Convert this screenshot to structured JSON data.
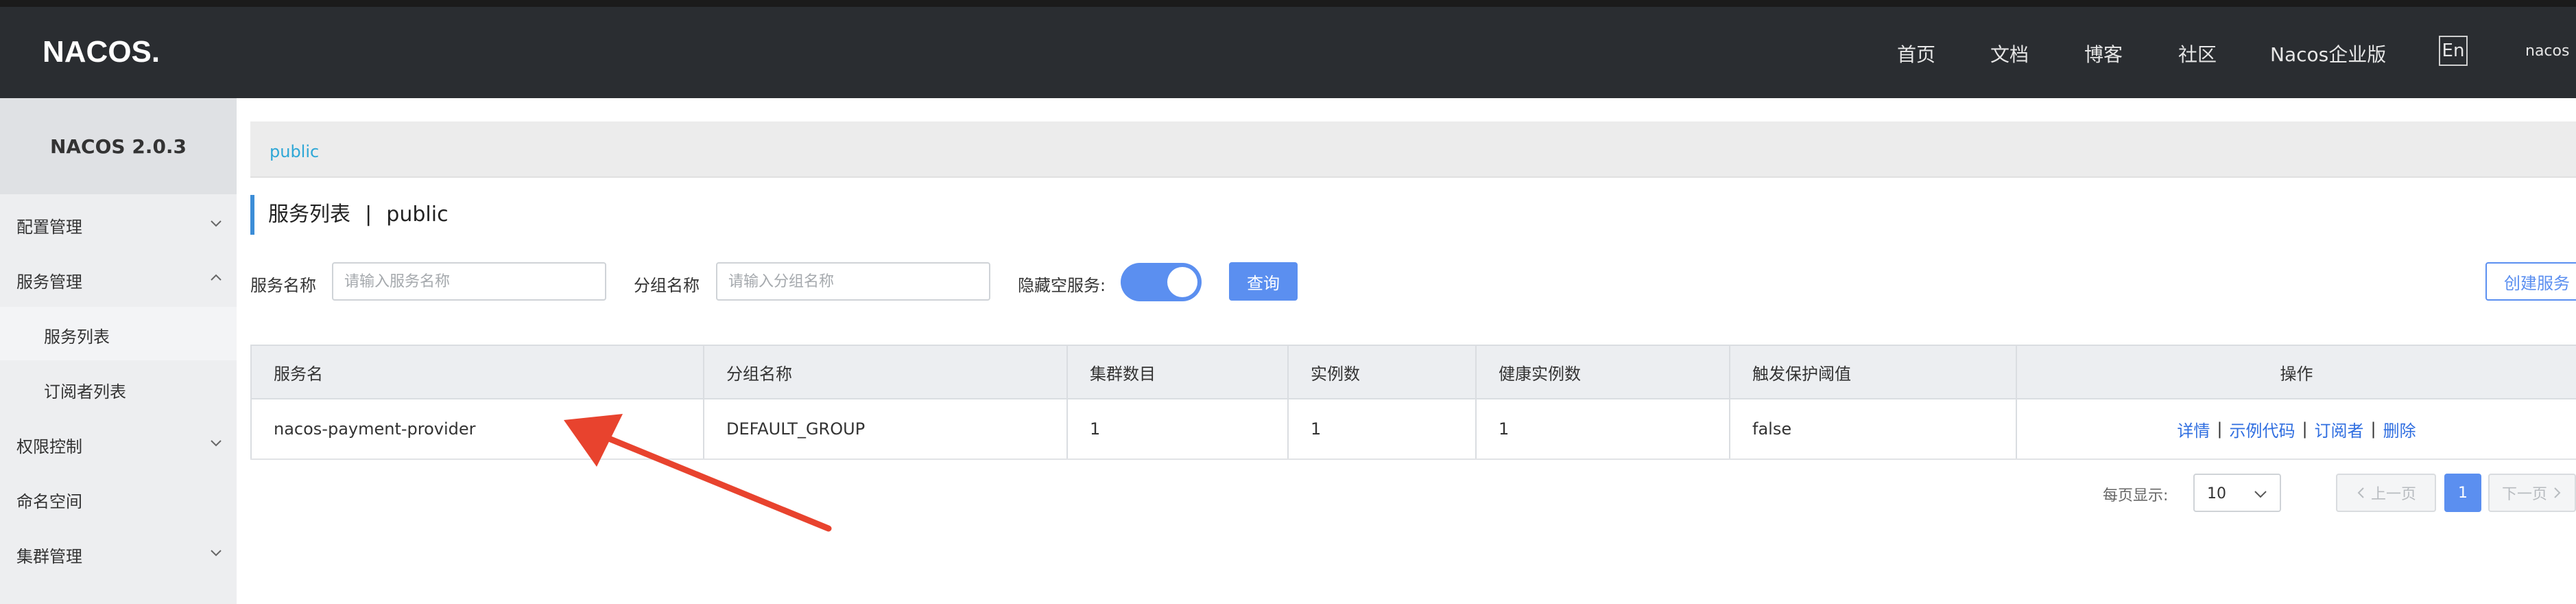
{
  "header": {
    "logo_text": "NACOS.",
    "nav": [
      "首页",
      "文档",
      "博客",
      "社区",
      "Nacos企业版"
    ],
    "lang_button": "En",
    "user": "nacos"
  },
  "sidebar": {
    "title": "NACOS 2.0.3",
    "items": [
      {
        "label": "配置管理"
      },
      {
        "label": "服务管理"
      },
      {
        "label": "服务列表"
      },
      {
        "label": "订阅者列表"
      },
      {
        "label": "权限控制"
      },
      {
        "label": "命名空间"
      },
      {
        "label": "集群管理"
      }
    ]
  },
  "tabbar": {
    "namespace": "public"
  },
  "page": {
    "title": "服务列表",
    "divider": "|",
    "namespace": "public"
  },
  "filters": {
    "service_name_label": "服务名称",
    "service_name_placeholder": "请输入服务名称",
    "group_name_label": "分组名称",
    "group_name_placeholder": "请输入分组名称",
    "hide_empty_label": "隐藏空服务:",
    "hide_empty_enabled": true,
    "query_button": "查询",
    "create_button": "创建服务"
  },
  "table": {
    "columns": [
      "服务名",
      "分组名称",
      "集群数目",
      "实例数",
      "健康实例数",
      "触发保护阈值",
      "操作"
    ],
    "rows": [
      {
        "service": "nacos-payment-provider",
        "group": "DEFAULT_GROUP",
        "clusters": "1",
        "instances": "1",
        "healthy": "1",
        "threshold": "false"
      }
    ],
    "actions": [
      "详情",
      "示例代码",
      "订阅者",
      "删除"
    ],
    "action_separator": "|"
  },
  "pagination": {
    "per_page_label": "每页显示:",
    "per_page_value": "10",
    "prev": "上一页",
    "current": "1",
    "next": "下一页"
  },
  "colors": {
    "header_bg": "#2a2d31",
    "accent": "#5b8ff0",
    "link": "#2f6ee0",
    "annotation_arrow": "#e8432e"
  },
  "icons": {
    "chevron_down": "chevron-down-icon",
    "chevron_up": "chevron-up-icon",
    "select_arrow": "chevron-down-icon",
    "annotation": "red-arrow-annotation"
  }
}
